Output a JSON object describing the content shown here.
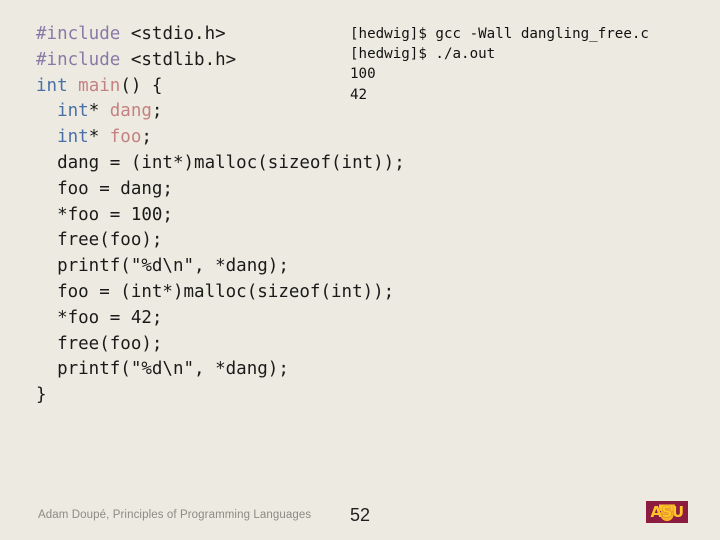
{
  "slide": {
    "code": {
      "language": "c",
      "lines": [
        [
          {
            "t": "#include",
            "c": "pre"
          },
          {
            "t": " <stdio.h>",
            "c": "plain"
          }
        ],
        [
          {
            "t": "#include",
            "c": "pre"
          },
          {
            "t": " <stdlib.h>",
            "c": "plain"
          }
        ],
        [
          {
            "t": "int",
            "c": "kw"
          },
          {
            "t": " ",
            "c": "plain"
          },
          {
            "t": "main",
            "c": "fn"
          },
          {
            "t": "() {",
            "c": "plain"
          }
        ],
        [
          {
            "t": "  ",
            "c": "plain"
          },
          {
            "t": "int",
            "c": "kw"
          },
          {
            "t": "* ",
            "c": "plain"
          },
          {
            "t": "dang",
            "c": "fn"
          },
          {
            "t": ";",
            "c": "plain"
          }
        ],
        [
          {
            "t": "  ",
            "c": "plain"
          },
          {
            "t": "int",
            "c": "kw"
          },
          {
            "t": "* ",
            "c": "plain"
          },
          {
            "t": "foo",
            "c": "fn"
          },
          {
            "t": ";",
            "c": "plain"
          }
        ],
        [
          {
            "t": "  dang = (int*)malloc(sizeof(int));",
            "c": "plain"
          }
        ],
        [
          {
            "t": "  foo = dang;",
            "c": "plain"
          }
        ],
        [
          {
            "t": "  *foo = 100;",
            "c": "plain"
          }
        ],
        [
          {
            "t": "  free(foo);",
            "c": "plain"
          }
        ],
        [
          {
            "t": "  printf(\"%d\\n\", *dang);",
            "c": "plain"
          }
        ],
        [
          {
            "t": "  foo = (int*)malloc(sizeof(int));",
            "c": "plain"
          }
        ],
        [
          {
            "t": "  *foo = 42;",
            "c": "plain"
          }
        ],
        [
          {
            "t": "  free(foo);",
            "c": "plain"
          }
        ],
        [
          {
            "t": "  printf(\"%d\\n\", *dang);",
            "c": "plain"
          }
        ],
        [
          {
            "t": "}",
            "c": "plain"
          }
        ]
      ]
    },
    "terminal": {
      "lines": [
        "[hedwig]$ gcc -Wall dangling_free.c",
        "[hedwig]$ ./a.out",
        "100",
        "42"
      ]
    },
    "footer": {
      "credit": "Adam Doupé, Principles of Programming Languages",
      "page_number": "52",
      "logo_text": "ASU"
    },
    "colors": {
      "background": "#edebe1",
      "code_plain": "#1a1a1a",
      "code_preprocessor": "#8a78a6",
      "code_keyword": "#4a6fa8",
      "code_identifier": "#c58181",
      "terminal_text": "#111111",
      "footer_credit": "#8b8b84",
      "page_number": "#1f1f1f",
      "logo_maroon": "#8c1d40",
      "logo_gold": "#ffc627"
    }
  }
}
